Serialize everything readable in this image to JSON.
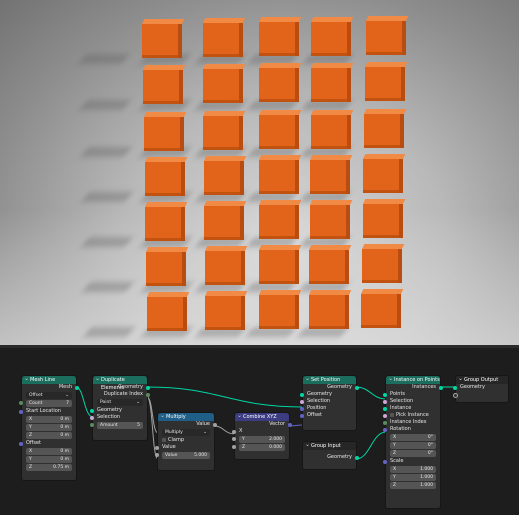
{
  "nodes": {
    "mesh_line": {
      "title": "Mesh Line",
      "output": "Mesh",
      "mode": "Offset",
      "count_label": "Count",
      "count_value": "7",
      "start_location": "Start Location",
      "sx": "X",
      "sx_v": "0 m",
      "sy": "Y",
      "sy_v": "0 m",
      "sz": "Z",
      "sz_v": "0 m",
      "offset": "Offset",
      "ox": "X",
      "ox_v": "0 m",
      "oy": "Y",
      "oy_v": "0 m",
      "oz": "Z",
      "oz_v": "0.75 m"
    },
    "duplicate": {
      "title": "Duplicate Elements",
      "geometry_out": "Geometry",
      "index_out": "Duplicate Index",
      "domain": "Point",
      "geometry_in": "Geometry",
      "selection": "Selection",
      "amount_label": "Amount",
      "amount_value": "5"
    },
    "multiply": {
      "title": "Multiply",
      "value_out": "Value",
      "operation": "Multiply",
      "clamp": "Clamp",
      "value_in": "Value",
      "value2_label": "Value",
      "value2": "5.000"
    },
    "combine": {
      "title": "Combine XYZ",
      "vector_out": "Vector",
      "x": "X",
      "y": "Y",
      "y_v": "2.000",
      "z": "Z",
      "z_v": "0.000"
    },
    "set_position": {
      "title": "Set Position",
      "geometry_out": "Geometry",
      "geometry_in": "Geometry",
      "selection": "Selection",
      "position": "Position",
      "offset": "Offset"
    },
    "group_input": {
      "title": "Group Input",
      "geometry": "Geometry"
    },
    "instance": {
      "title": "Instance on Points",
      "instances_out": "Instances",
      "points": "Points",
      "selection": "Selection",
      "instance": "Instance",
      "pick": "Pick Instance",
      "index": "Instance Index",
      "rotation": "Rotation",
      "rx": "X",
      "rx_v": "0°",
      "ry": "Y",
      "ry_v": "0°",
      "rz": "Z",
      "rz_v": "0°",
      "scale": "Scale",
      "scx": "X",
      "scx_v": "1.000",
      "scy": "Y",
      "scy_v": "1.000",
      "scz": "Z",
      "scz_v": "1.000"
    },
    "group_output": {
      "title": "Group Output",
      "geometry": "Geometry"
    }
  },
  "colors": {
    "geometry": "#00d6a3",
    "float": "#a1a1a1",
    "vector": "#6363c7",
    "header_geo": "#1b6d5d",
    "header_math": "#1f5e86",
    "header_vec": "#3c3c83",
    "cube": "#e2631a"
  }
}
